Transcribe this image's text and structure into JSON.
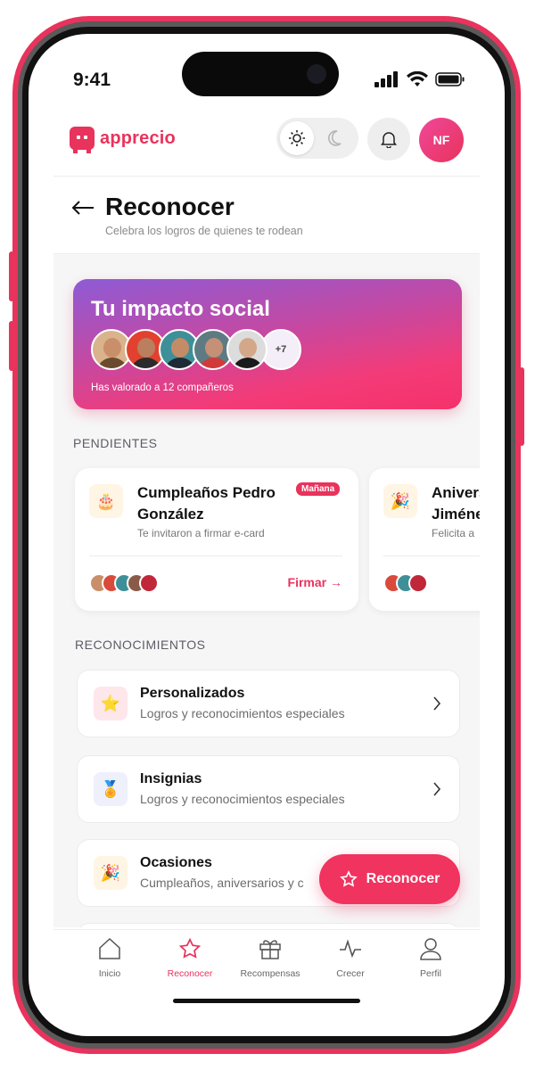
{
  "status": {
    "time": "9:41"
  },
  "header": {
    "brand": "apprecio",
    "avatar_initials": "NF"
  },
  "page": {
    "title": "Reconocer",
    "subtitle": "Celebra los logros de quienes te rodean"
  },
  "impact": {
    "title": "Tu impacto social",
    "more_count": "+7",
    "summary": "Has valorado a 12 compañeros"
  },
  "pending": {
    "section_label": "PENDIENTES",
    "cards": [
      {
        "title": "Cumpleaños Pedro González",
        "badge": "Mañana",
        "description": "Te invitaron a firmar e-card",
        "action": "Firmar →",
        "icon": "birthday-cake-icon"
      },
      {
        "title": "Aniversario Jiménez",
        "description": "Felicita a",
        "icon": "party-icon"
      }
    ]
  },
  "recognitions": {
    "section_label": "RECONOCIMIENTOS",
    "items": [
      {
        "name": "Personalizados",
        "description": "Logros y reconocimientos especiales",
        "icon": "star-icon",
        "icon_bg": "#fde7ea"
      },
      {
        "name": "Insignias",
        "description": "Logros y reconocimientos especiales",
        "icon": "medal-icon",
        "icon_bg": "#eef0fb"
      },
      {
        "name": "Ocasiones",
        "description": "Cumpleaños, aniversarios y c",
        "icon": "party-popper-icon",
        "icon_bg": "#fff5e4"
      }
    ]
  },
  "fab": {
    "label": "Reconocer"
  },
  "nav": {
    "items": [
      {
        "label": "Inicio"
      },
      {
        "label": "Reconocer"
      },
      {
        "label": "Recompensas"
      },
      {
        "label": "Crecer"
      },
      {
        "label": "Perfil"
      }
    ]
  },
  "colors": {
    "accent": "#e8335c"
  }
}
